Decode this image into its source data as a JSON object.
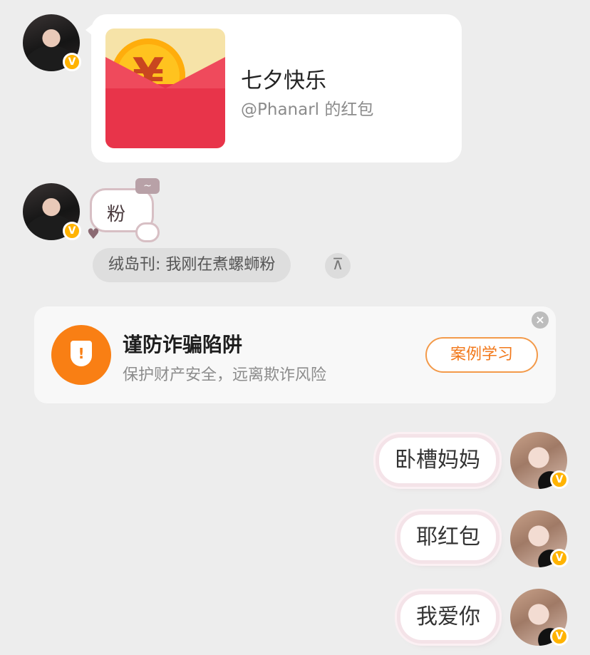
{
  "messages": {
    "red_packet": {
      "title": "七夕快乐",
      "sender": "@Phanarl 的红包",
      "currency_symbol": "¥"
    },
    "sticker": {
      "text": "粉"
    },
    "quote": {
      "text": "绒岛刊: 我刚在煮螺蛳粉",
      "pin_icon_glyph": "⊼"
    },
    "fraud_warning": {
      "title": "谨防诈骗陷阱",
      "subtitle": "保护财产安全，远离欺诈风险",
      "button_label": "案例学习",
      "close_glyph": "×",
      "icon_glyph": "!"
    },
    "outgoing": [
      {
        "text": "卧槽妈妈"
      },
      {
        "text": "耶红包"
      },
      {
        "text": "我爱你"
      }
    ]
  },
  "badges": {
    "verified_glyph": "V"
  },
  "colors": {
    "background": "#ededed",
    "red_packet": "#e8344a",
    "coin": "#ffc31f",
    "warning_orange": "#f97f14",
    "verified_badge": "#ffb300"
  }
}
